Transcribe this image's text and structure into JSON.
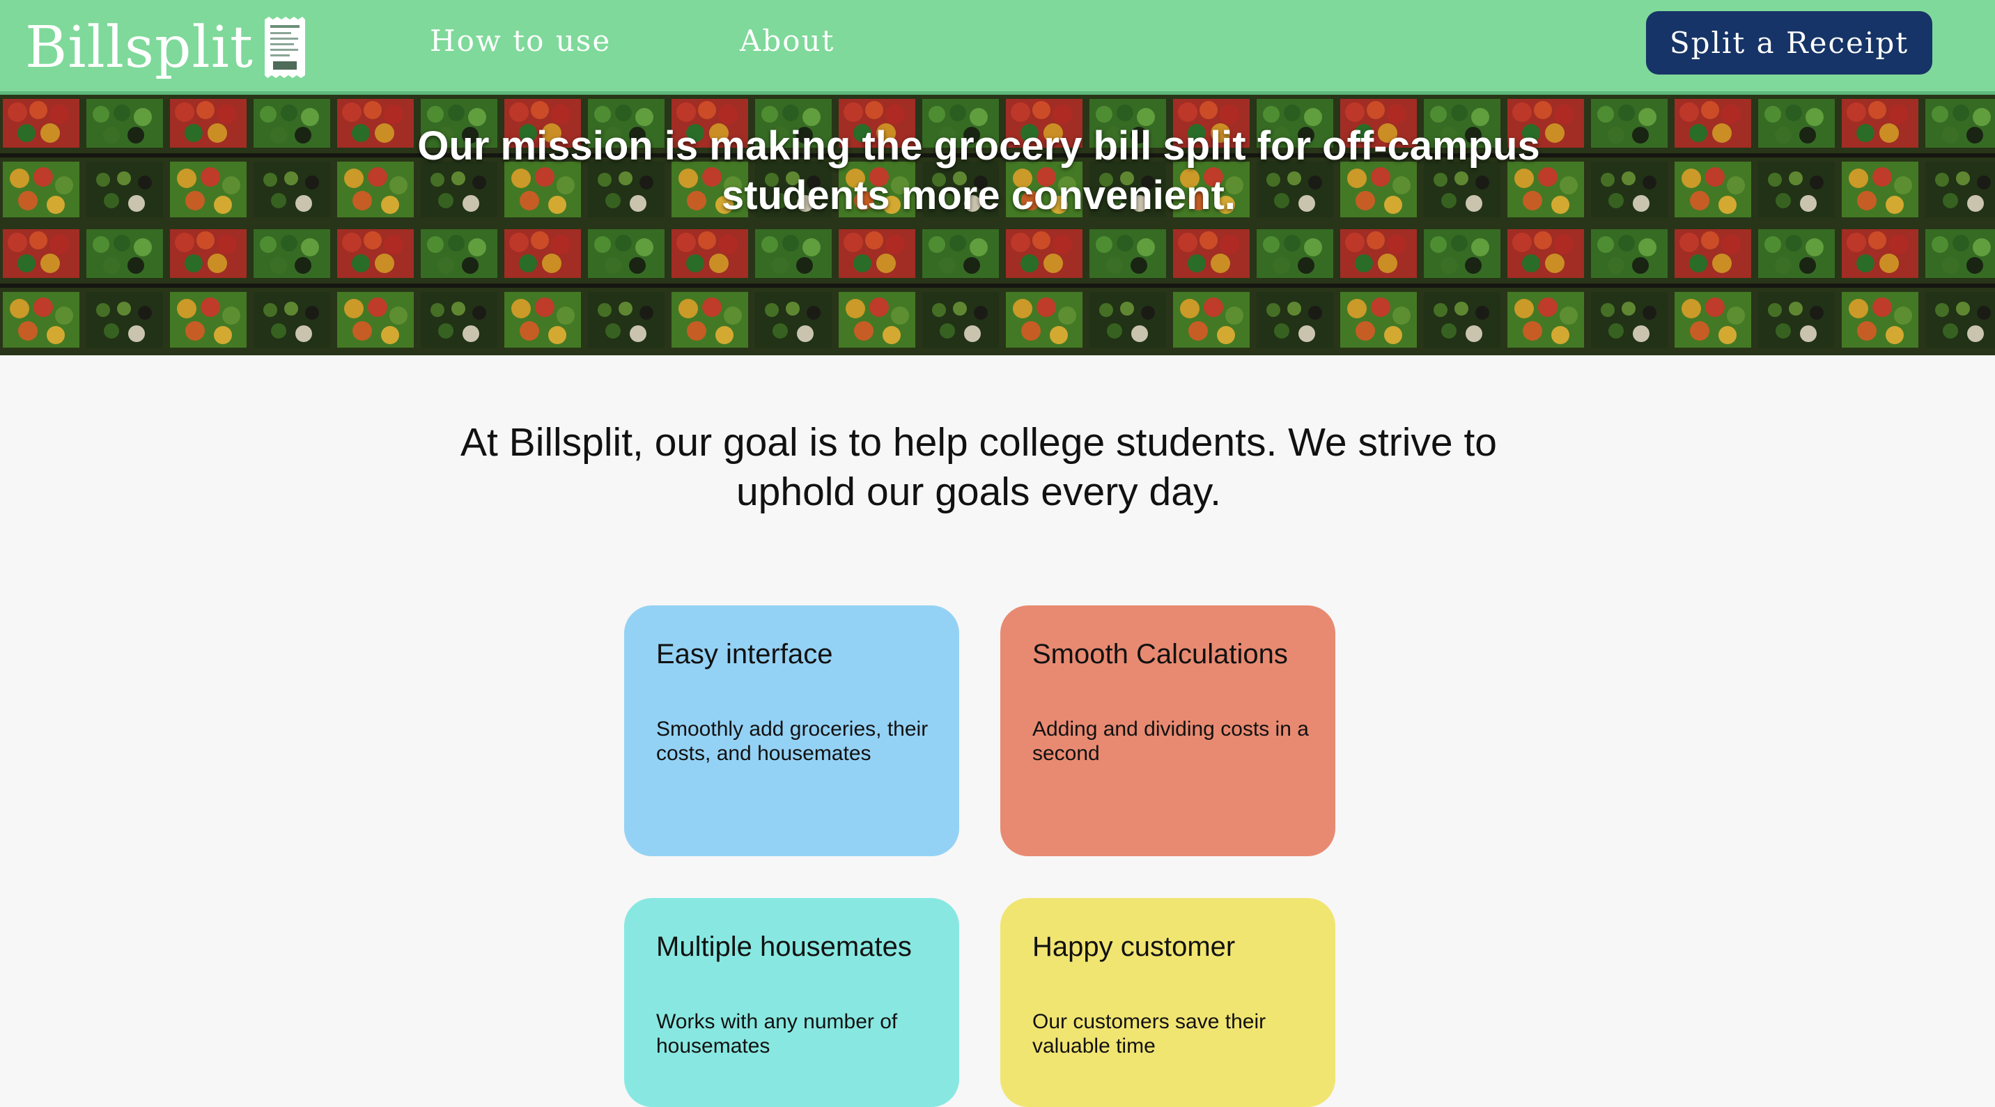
{
  "navbar": {
    "brand": "Billsplit",
    "links": [
      "How to use",
      "About"
    ],
    "cta_label": "Split a Receipt",
    "background_color": "#7fd99a",
    "cta_color": "#163467"
  },
  "hero": {
    "title": "Our mission is making the grocery bill split for off-campus students more convenient."
  },
  "intro": {
    "text": "At Billsplit, our goal is to help college students. We strive to uphold our goals every day."
  },
  "features": [
    {
      "title": "Easy interface",
      "description": "Smoothly add groceries, their costs, and housemates",
      "color": "#94d2f5"
    },
    {
      "title": "Smooth Calculations",
      "description": "Adding and dividing costs in a second",
      "color": "#e88a71"
    },
    {
      "title": "Multiple housemates",
      "description": "Works with any number of housemates",
      "color": "#88e8e1"
    },
    {
      "title": "Happy customer",
      "description": "Our customers save their valuable time",
      "color": "#f1e572"
    }
  ]
}
